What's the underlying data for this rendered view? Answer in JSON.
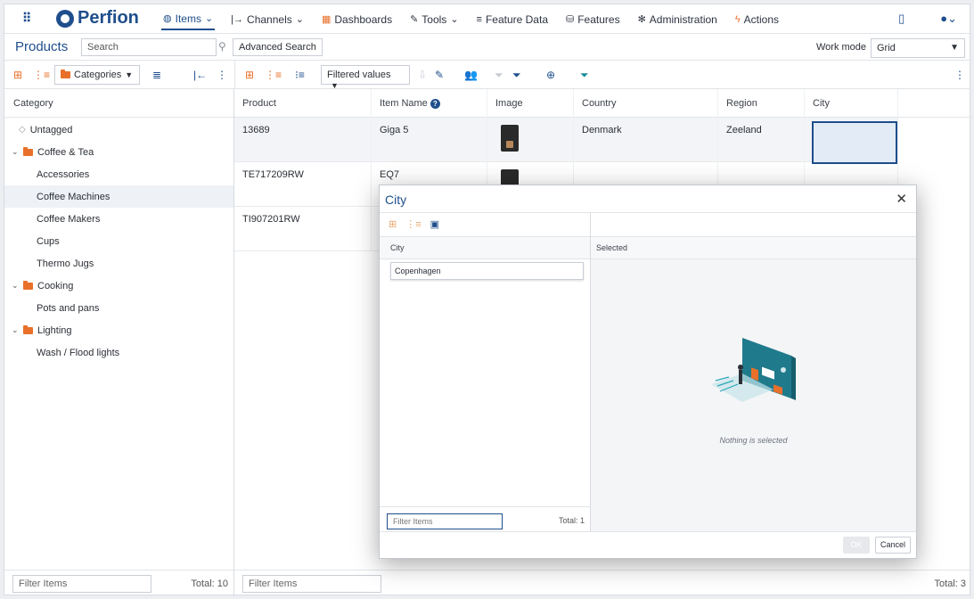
{
  "nav": {
    "logo": "Perfion",
    "items": [
      {
        "label": "Items",
        "icon": "cube-icon",
        "caret": true,
        "active": true
      },
      {
        "label": "Channels",
        "icon": "channels-icon",
        "caret": true
      },
      {
        "label": "Dashboards",
        "icon": "dashboard-icon",
        "caret": false
      },
      {
        "label": "Tools",
        "icon": "tools-icon",
        "caret": true
      },
      {
        "label": "Feature Data",
        "icon": "list-icon",
        "caret": false
      },
      {
        "label": "Features",
        "icon": "database-icon",
        "caret": false
      },
      {
        "label": "Administration",
        "icon": "gear-icon",
        "caret": false
      },
      {
        "label": "Actions",
        "icon": "lightning-icon",
        "caret": false
      }
    ]
  },
  "header": {
    "title": "Products",
    "search_placeholder": "Search",
    "advanced_search": "Advanced Search",
    "work_mode_label": "Work mode",
    "work_mode_value": "Grid"
  },
  "toolbar": {
    "categories_label": "Categories",
    "filtered_values_label": "Filtered values"
  },
  "left": {
    "column_header": "Category",
    "tree": [
      {
        "label": "Untagged",
        "level": 0,
        "type": "tag"
      },
      {
        "label": "Coffee & Tea",
        "level": 0,
        "type": "folder"
      },
      {
        "label": "Accessories",
        "level": 1,
        "type": "leaf"
      },
      {
        "label": "Coffee Machines",
        "level": 1,
        "type": "leaf",
        "selected": true
      },
      {
        "label": "Coffee Makers",
        "level": 1,
        "type": "leaf"
      },
      {
        "label": "Cups",
        "level": 1,
        "type": "leaf"
      },
      {
        "label": "Thermo Jugs",
        "level": 1,
        "type": "leaf"
      },
      {
        "label": "Cooking",
        "level": 0,
        "type": "folder"
      },
      {
        "label": "Pots and pans",
        "level": 1,
        "type": "leaf"
      },
      {
        "label": "Lighting",
        "level": 0,
        "type": "folder"
      },
      {
        "label": "Wash / Flood lights",
        "level": 1,
        "type": "leaf"
      }
    ],
    "filter_placeholder": "Filter Items",
    "total": "Total: 10"
  },
  "grid": {
    "columns": [
      "Product",
      "Item Name",
      "Image",
      "Country",
      "Region",
      "City"
    ],
    "rows": [
      {
        "product": "13689",
        "item_name": "Giga 5",
        "country": "Denmark",
        "region": "Zeeland",
        "city": ""
      },
      {
        "product": "TE717209RW",
        "item_name": "EQ7",
        "country": "",
        "region": "",
        "city": ""
      },
      {
        "product": "TI907201RW",
        "item_name": "",
        "country": "",
        "region": "",
        "city": ""
      }
    ],
    "filter_placeholder": "Filter Items",
    "total": "Total: 3"
  },
  "modal": {
    "title": "City",
    "left_header": "City",
    "right_header": "Selected",
    "city_value": "Copenhagen",
    "filter_placeholder": "Filter Items",
    "total": "Total: 1",
    "empty_text": "Nothing is selected",
    "ok": "OK",
    "cancel": "Cancel"
  },
  "colors": {
    "brand": "#1f4e8c",
    "accent": "#e8702a"
  }
}
